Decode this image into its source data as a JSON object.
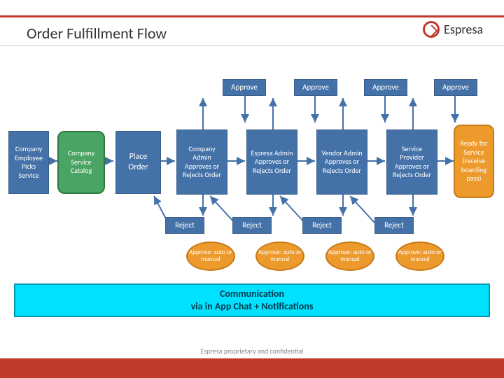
{
  "title": "Order Fulfillment Flow",
  "brand": "Espresa",
  "nodes": {
    "n1": "Company Employee Picks Service",
    "n2": "Company Service Catalog",
    "n3": "Place Order",
    "n4": "Company Admin Approves or Rejects Order",
    "n5": "Espresa Admin Approves or Rejects Order",
    "n6": "Vendor Admin Approves or Rejects Order",
    "n7": "Service Provider Approves or Rejects Order",
    "n8": "Ready for Service (receive boarding pass)"
  },
  "approve": "Approve",
  "reject": "Reject",
  "oval": "Approve: auto or manual",
  "comm1": "Communication",
  "comm2": "via in App Chat + Notifications",
  "footer": "Espresa proprietary and confidential"
}
